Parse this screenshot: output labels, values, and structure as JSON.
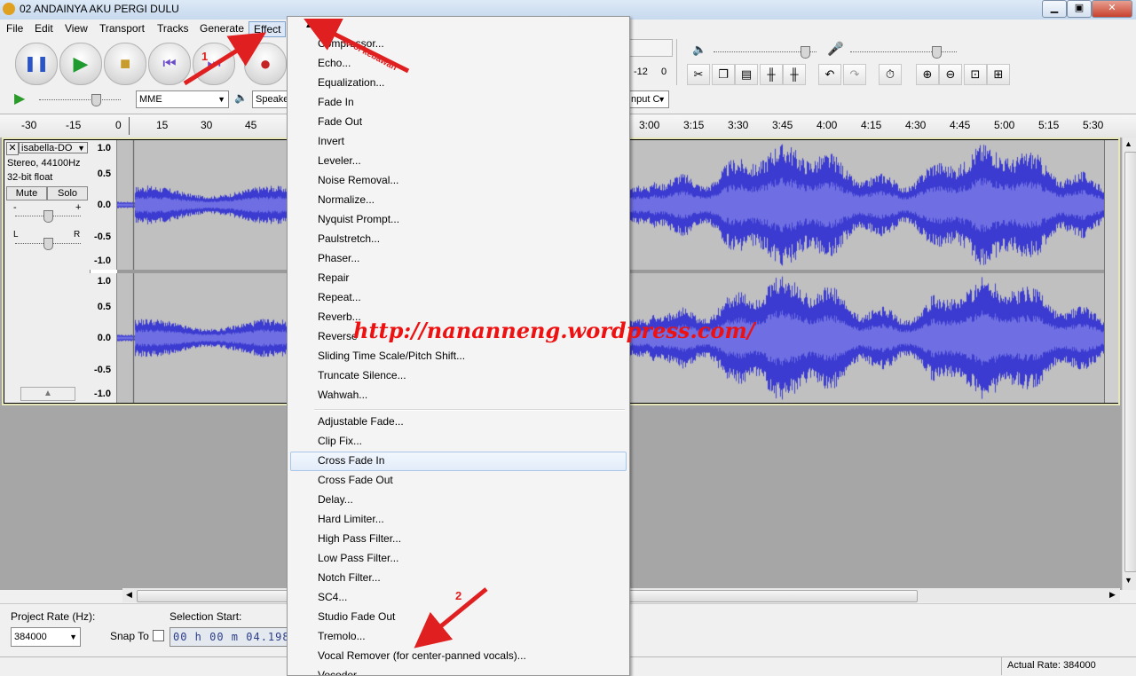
{
  "window": {
    "title": "02 ANDAINYA AKU PERGI DULU",
    "minimize_icon": "minimize-icon",
    "maximize_icon": "maximize-icon",
    "close_icon": "close-icon"
  },
  "menubar": {
    "items": [
      "File",
      "Edit",
      "View",
      "Transport",
      "Tracks",
      "Generate",
      "Effect"
    ],
    "active": "Effect"
  },
  "meter": {
    "left_value": "-12",
    "right_value": "0"
  },
  "device": {
    "host": "MME",
    "output": "Speake",
    "input_channels": "nput C"
  },
  "ruler": {
    "labels": [
      "-30",
      "-15",
      "0",
      "15",
      "30",
      "45",
      "3:00",
      "3:15",
      "3:30",
      "3:45",
      "4:00",
      "4:15",
      "4:30",
      "4:45",
      "5:00",
      "5:15",
      "5:30"
    ]
  },
  "track": {
    "name": "isabella-DO",
    "info_line1": "Stereo, 44100Hz",
    "info_line2": "32-bit float",
    "mute_label": "Mute",
    "solo_label": "Solo",
    "gain_minus": "-",
    "gain_plus": "+",
    "pan_left": "L",
    "pan_right": "R",
    "scale_labels": [
      "1.0",
      "0.5",
      "0.0",
      "-0.5",
      "-1.0"
    ]
  },
  "effect_menu": {
    "scroll_up_icon": "triangle-up-icon",
    "group1": [
      "Compressor...",
      "Echo...",
      "Equalization...",
      "Fade In",
      "Fade Out",
      "Invert",
      "Leveler...",
      "Noise Removal...",
      "Normalize...",
      "Nyquist Prompt...",
      "Paulstretch...",
      "Phaser...",
      "Repair",
      "Repeat...",
      "Reverb...",
      "Reverse",
      "Sliding Time Scale/Pitch Shift...",
      "Truncate Silence...",
      "Wahwah..."
    ],
    "group2": [
      "Adjustable Fade...",
      "Clip Fix...",
      "Cross Fade In",
      "Cross Fade Out",
      "Delay...",
      "Hard Limiter...",
      "High Pass Filter...",
      "Low Pass Filter...",
      "Notch Filter...",
      "SC4...",
      "Studio Fade Out",
      "Tremolo...",
      "Vocal Remover (for center-panned vocals)...",
      "Vocoder..."
    ],
    "highlighted": "Cross Fade In"
  },
  "selection_toolbar": {
    "project_rate_label": "Project Rate (Hz):",
    "project_rate_value": "384000",
    "snap_to_label": "Snap To",
    "selection_start_label": "Selection Start:",
    "selection_start_value": "00 h 00 m 04.198"
  },
  "status": {
    "actual_rate": "Actual Rate: 384000"
  },
  "annotations": {
    "watermark": "http://nananneng.wordpress.com/",
    "marker_1": "1",
    "marker_2": "2",
    "scroll_note": "scrol kebawah",
    "arrow_color": "#e02020"
  },
  "colors": {
    "waveform": "#3b3bd1",
    "waveform_rms": "#6f6fe3",
    "track_bg": "#c0c0c0",
    "highlight": "#dce8f7"
  }
}
